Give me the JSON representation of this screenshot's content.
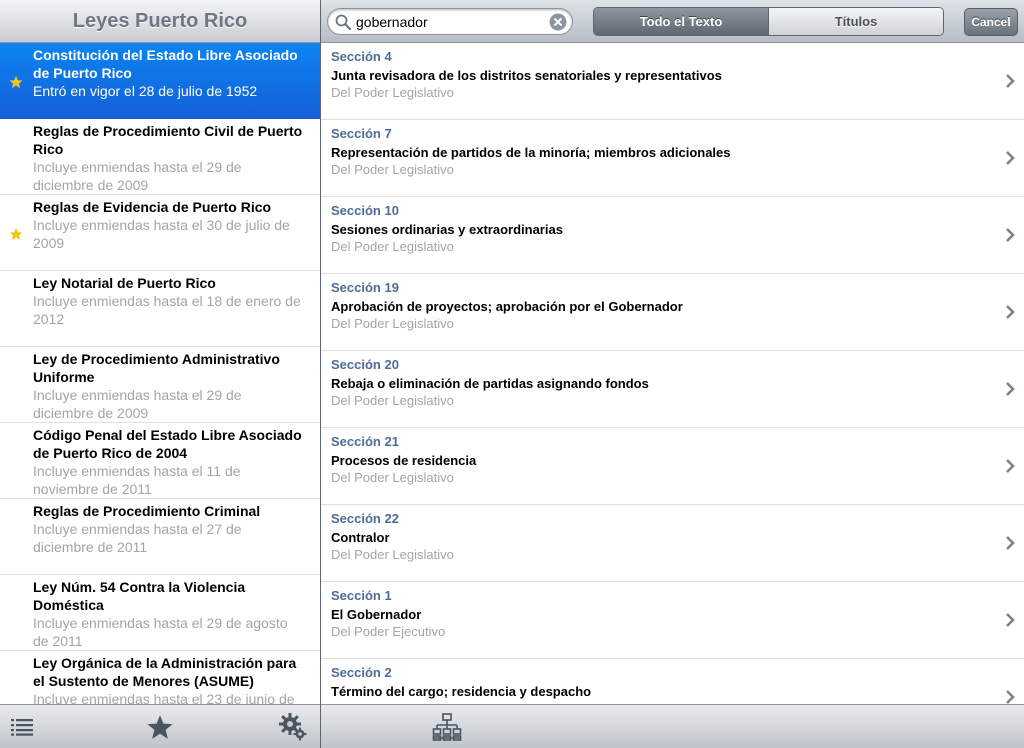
{
  "sidebar": {
    "title": "Leyes Puerto Rico",
    "items": [
      {
        "title": "Constitución del Estado Libre Asociado de Puerto Rico",
        "subtitle": "Entró en vigor el 28 de julio de 1952",
        "starred": true,
        "selected": true
      },
      {
        "title": "Reglas de Procedimiento Civil de Puerto Rico",
        "subtitle": "Incluye enmiendas hasta el 29 de diciembre de 2009",
        "starred": false,
        "selected": false
      },
      {
        "title": "Reglas de Evidencia de Puerto Rico",
        "subtitle": "Incluye enmiendas hasta el 30 de julio de 2009",
        "starred": true,
        "selected": false
      },
      {
        "title": "Ley Notarial de Puerto Rico",
        "subtitle": "Incluye enmiendas hasta el 18 de enero de 2012",
        "starred": false,
        "selected": false
      },
      {
        "title": "Ley de Procedimiento Administrativo Uniforme",
        "subtitle": "Incluye enmiendas hasta el 29 de diciembre de 2009",
        "starred": false,
        "selected": false
      },
      {
        "title": "Código Penal del Estado Libre Asociado de Puerto Rico de 2004",
        "subtitle": "Incluye enmiendas hasta el 11 de noviembre de 2011",
        "starred": false,
        "selected": false
      },
      {
        "title": "Reglas de Procedimiento Criminal",
        "subtitle": "Incluye enmiendas hasta el 27 de diciembre de 2011",
        "starred": false,
        "selected": false
      },
      {
        "title": "Ley Núm. 54 Contra la Violencia Doméstica",
        "subtitle": "Incluye enmiendas hasta el 29 de agosto de 2011",
        "starred": false,
        "selected": false
      },
      {
        "title": "Ley Orgánica de la Administración para el Sustento de Menores (ASUME)",
        "subtitle": "Incluye enmiendas hasta el 23 de junio de",
        "starred": false,
        "selected": false
      }
    ],
    "toolbar_icons": [
      "list-icon",
      "star-icon",
      "gear-icon"
    ]
  },
  "search": {
    "value": "gobernador",
    "scope_tabs": [
      {
        "label": "Todo el Texto",
        "active": true
      },
      {
        "label": "Títulos",
        "active": false
      }
    ],
    "cancel_label": "Cancel"
  },
  "results": [
    {
      "section": "Sección 4",
      "title": "Junta revisadora de los distritos senatoriales y representativos",
      "subtitle": "Del Poder Legislativo"
    },
    {
      "section": "Sección 7",
      "title": "Representación de partidos de la minoría; miembros adicionales",
      "subtitle": "Del Poder Legislativo"
    },
    {
      "section": "Sección 10",
      "title": "Sesiones ordinarias y extraordinarias",
      "subtitle": "Del Poder Legislativo"
    },
    {
      "section": "Sección 19",
      "title": "Aprobación de proyectos; aprobación por el Gobernador",
      "subtitle": "Del Poder Legislativo"
    },
    {
      "section": "Sección 20",
      "title": "Rebaja o eliminación de partidas asignando fondos",
      "subtitle": "Del Poder Legislativo"
    },
    {
      "section": "Sección 21",
      "title": "Procesos de residencia",
      "subtitle": "Del Poder Legislativo"
    },
    {
      "section": "Sección 22",
      "title": "Contralor",
      "subtitle": "Del Poder Legislativo"
    },
    {
      "section": "Sección 1",
      "title": "El Gobernador",
      "subtitle": "Del Poder Ejecutivo"
    },
    {
      "section": "Sección 2",
      "title": "Término del cargo; residencia y despacho",
      "subtitle": ""
    }
  ],
  "right_toolbar_icons": [
    "hierarchy-icon"
  ],
  "colors": {
    "selection": "#0a84f2",
    "section_label": "#4f6c97",
    "subtitle": "#a4a4a4",
    "star": "#f5c518"
  }
}
